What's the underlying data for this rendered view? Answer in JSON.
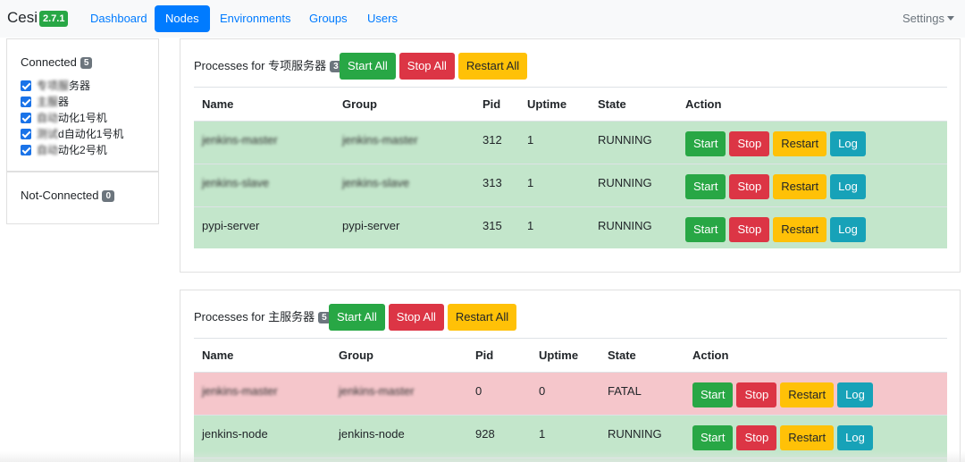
{
  "nav": {
    "brand": "Cesi",
    "version": "2.7.1",
    "links": [
      {
        "label": "Dashboard",
        "active": false
      },
      {
        "label": "Nodes",
        "active": true
      },
      {
        "label": "Environments",
        "active": false
      },
      {
        "label": "Groups",
        "active": false
      },
      {
        "label": "Users",
        "active": false
      }
    ],
    "settings": "Settings"
  },
  "sidebar": {
    "connected_label": "Connected",
    "connected_count": "5",
    "nodes": [
      {
        "prefix": "专项服",
        "label": "务器",
        "checked": true
      },
      {
        "prefix": "主服",
        "label": "器",
        "checked": true
      },
      {
        "prefix": "自动",
        "label": "动化1号机",
        "checked": true
      },
      {
        "prefix": "测试",
        "label": "d自动化1号机",
        "checked": true
      },
      {
        "prefix": "自动",
        "label": "动化2号机",
        "checked": true
      }
    ],
    "not_connected_label": "Not-Connected",
    "not_connected_count": "0"
  },
  "labels": {
    "processes_for": "Processes for",
    "start_all": "Start All",
    "stop_all": "Stop All",
    "restart_all": "Restart All",
    "start": "Start",
    "stop": "Stop",
    "restart": "Restart",
    "log": "Log"
  },
  "columns": [
    "Name",
    "Group",
    "Pid",
    "Uptime",
    "State",
    "Action"
  ],
  "panels": [
    {
      "node": "专项服务器",
      "count": "3",
      "rows": [
        {
          "name": "jenkins-master",
          "group": "jenkins-master",
          "pid": "312",
          "uptime": "1",
          "state": "RUNNING",
          "status": "ok",
          "name_hidden": true,
          "group_hidden": true
        },
        {
          "name": "jenkins-slave",
          "group": "jenkins-slave",
          "pid": "313",
          "uptime": "1",
          "state": "RUNNING",
          "status": "ok",
          "name_hidden": true,
          "group_hidden": true
        },
        {
          "name": "pypi-server",
          "group": "pypi-server",
          "pid": "315",
          "uptime": "1",
          "state": "RUNNING",
          "status": "ok",
          "name_hidden": false,
          "group_hidden": false
        }
      ]
    },
    {
      "node": "主服务器",
      "count": "5",
      "rows": [
        {
          "name": "jenkins-master",
          "group": "jenkins-master",
          "pid": "0",
          "uptime": "0",
          "state": "FATAL",
          "status": "bad",
          "name_hidden": true,
          "group_hidden": true
        },
        {
          "name": "jenkins-node",
          "group": "jenkins-node",
          "pid": "928",
          "uptime": "1",
          "state": "RUNNING",
          "status": "ok",
          "name_hidden": false,
          "group_hidden": false
        }
      ]
    }
  ],
  "colors": {
    "primary": "#007bff",
    "success": "#28a745",
    "danger": "#dc3545",
    "warning": "#ffc107",
    "info": "#17a2b8",
    "row_ok": "#c3e6cb",
    "row_bad": "#f5c6cb"
  }
}
